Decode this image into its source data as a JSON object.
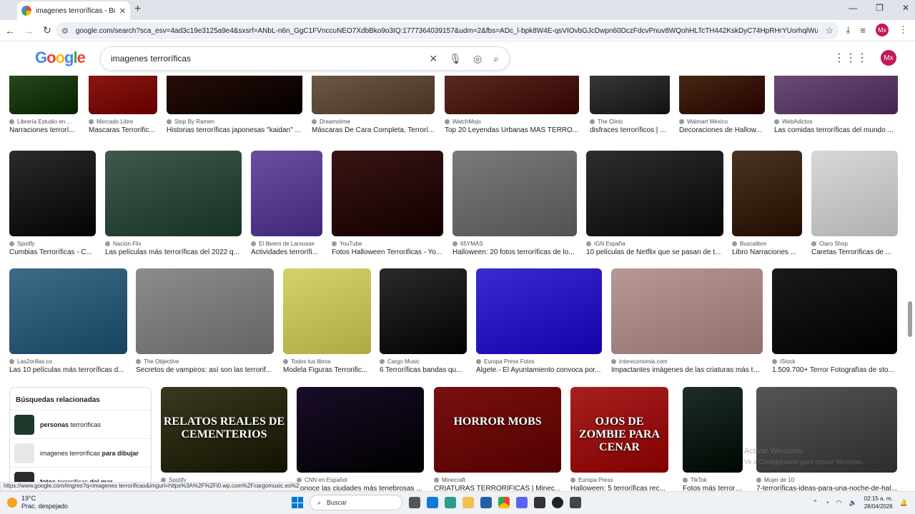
{
  "browser": {
    "tab_title": "imagenes terroríficas - Buscar c",
    "url": "google.com/search?sca_esv=4ad3c19e3125a9e4&sxsrf=ANbL-n6n_GgC1FVnccuNEO7XdbBko9o3IQ:1777364039157&udm=2&fbs=ADc_l-bpk8W4E-qsVIOvbGJcDwpn60DczFdcvPnuv8WQohHLTcTH442KskDyC74HpRHrYUorhqlWu6eEEK7aBAtTZpD8Et4...",
    "profile": "Mx"
  },
  "google": {
    "logo": "Google",
    "query": "imagenes terroríficas",
    "profile": "Mx"
  },
  "rows": [
    [
      {
        "source": "Librería Estudio en ...",
        "caption": "Narraciones terrorí...",
        "img": "#2c4a1e"
      },
      {
        "source": "Mercado Libre",
        "caption": "Mascaras Terrorific...",
        "img": "#8a1a12"
      },
      {
        "source": "Stop By Ramen",
        "caption": "Historias terroríficas japonesas \"kaidan\" ...",
        "img": "#2a0e08"
      },
      {
        "source": "Dreamstime",
        "caption": "Máscaras De Cara Completa, Terrorí...",
        "img": "#6d5a48"
      },
      {
        "source": "WatchMojo",
        "caption": "Top 20 Leyendas Urbanas MÁS TERRO...",
        "img": "#5a2c24"
      },
      {
        "source": "The Clinic",
        "caption": "disfraces terroríficos | ...",
        "img": "#3a3a3a"
      },
      {
        "source": "Walmart México",
        "caption": "Decoraciones de Hallow...",
        "img": "#4a2a14"
      },
      {
        "source": "WebAdictos",
        "caption": "Las comidas terroríficas del mundo ...",
        "img": "#6e4c7a"
      }
    ],
    [
      {
        "source": "Spotify",
        "caption": "Cumbias Terroríficas - C...",
        "img": "#2b2b2b"
      },
      {
        "source": "Nación Flix",
        "caption": "Las películas más terroríficas del 2022 q...",
        "img": "#3e5a4c"
      },
      {
        "source": "El librero de Larousse",
        "caption": "Actividades terrorífi...",
        "img": "#6a4fa0"
      },
      {
        "source": "YouTube",
        "caption": "Fotos Halloween Terrorificas - Yo...",
        "img": "#3a1414"
      },
      {
        "source": "65YMÁS",
        "caption": "Halloween: 20 fotos terroríficas de lo...",
        "img": "#7a7a7a"
      },
      {
        "source": "IGN España",
        "caption": "10 películas de Netflix que se pasan de t...",
        "img": "#2e2e2e"
      },
      {
        "source": "Buscalibre",
        "caption": "Libro Narraciones ...",
        "img": "#4a3420"
      },
      {
        "source": "Claro Shop",
        "caption": "Caretas Terroríficas de ...",
        "img": "#d8d8d8"
      }
    ],
    [
      {
        "source": "Las2orillas.co",
        "caption": "Las 10 películas más terroríficas d...",
        "img": "#3e6c88"
      },
      {
        "source": "The Objective",
        "caption": "Secretos de vampiros: así son las terrorif...",
        "img": "#8c8c8c"
      },
      {
        "source": "Todos tus libros",
        "caption": "Modela Figuras Terrorific...",
        "img": "#d6d26a"
      },
      {
        "source": "Cargo Music",
        "caption": "6 Terroríficas bandas qu...",
        "img": "#2a2a2a"
      },
      {
        "source": "Europa Press Fotos",
        "caption": "Algete.- El Ayuntamiento convoca por...",
        "img": "#3a2ad0"
      },
      {
        "source": "intereconomia.com",
        "caption": "Impactantes imágenes de las criaturas más te...",
        "img": "#b89894"
      },
      {
        "source": "iStock",
        "caption": "1.509.700+ Terror Fotografías de sto...",
        "img": "#1a1a1a"
      }
    ],
    [
      {
        "source": "Spotify",
        "caption": "",
        "img": "#3a3a20"
      },
      {
        "source": "CNN en Español",
        "caption": "conoce las ciudades más tenebrosas ...",
        "img": "#1a0c28"
      },
      {
        "source": "Minecraft",
        "caption": "CRIATURAS TERRORÍFICAS | Minec...",
        "img": "#7a1010"
      },
      {
        "source": "Europa Press",
        "caption": "Halloween: 5 terroríficas rec...",
        "img": "#a82020"
      },
      {
        "source": "TikTok",
        "caption": "Fotos más terrorífi...",
        "img": "#1e2e28"
      },
      {
        "source": "Mujer de 10",
        "caption": "7-terroríficas-ideas-para-una-noche-de-hal...",
        "img": "#555555"
      }
    ]
  ],
  "overlays": {
    "row4_0": "RELATOS REALES DE CEMENTERIOS",
    "row4_3": "OJOS DE ZOMBIE PARA CENAR",
    "row4_2": "HORROR MOBS"
  },
  "related": {
    "heading": "Búsquedas relacionadas",
    "items": [
      {
        "bold": "personas",
        "rest": " terroríficas"
      },
      {
        "pre": "imagenes terroríficas ",
        "bold": "para dibujar"
      },
      {
        "bold": "fotos",
        "rest": " terroríficas ",
        "bold2": "del mar"
      }
    ]
  },
  "status_url": "https://www.google.com/imgres?q=imagenes terroríficas&imgurl=https%3A%2F%2Fi0.wp.com%2Fcargomusic.es%2...",
  "watermark": {
    "title": "Activar Windows",
    "sub": "Ve a Configuración para activar Windows."
  },
  "taskbar": {
    "temp": "19°C",
    "weather": "Prac. despejado",
    "search": "Buscar",
    "time": "02:15 a. m.",
    "date": "28/04/2026"
  }
}
